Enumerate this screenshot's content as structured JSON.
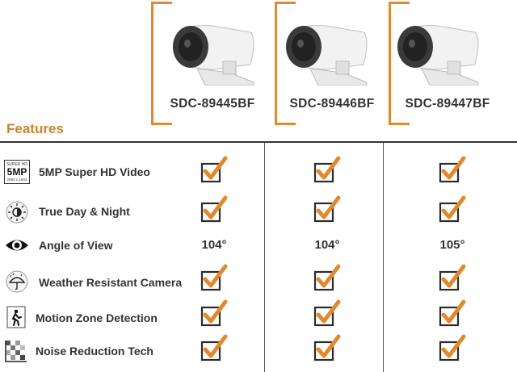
{
  "colors": {
    "accent": "#E0892D",
    "title": "#C8852B",
    "text": "#333333"
  },
  "products": [
    {
      "model": "SDC-89445BF"
    },
    {
      "model": "SDC-89446BF"
    },
    {
      "model": "SDC-89447BF"
    }
  ],
  "features_title": "Features",
  "features": [
    {
      "label": "5MP Super HD Video",
      "icon": "5mp-icon",
      "icon_text": [
        "SUPER HD",
        "5MP",
        "2592 x 1944"
      ],
      "values": [
        "check",
        "check",
        "check"
      ]
    },
    {
      "label": "True Day & Night",
      "icon": "sun-moon-icon",
      "values": [
        "check",
        "check",
        "check"
      ]
    },
    {
      "label": "Angle of View",
      "icon": "eye-icon",
      "values": [
        "104°",
        "104°",
        "105°"
      ]
    },
    {
      "label": "Weather Resistant Camera",
      "icon": "umbrella-icon",
      "values": [
        "check",
        "check",
        "check"
      ]
    },
    {
      "label": "Motion Zone Detection",
      "icon": "motion-icon",
      "values": [
        "check",
        "check",
        "check"
      ]
    },
    {
      "label": "Noise Reduction Tech",
      "icon": "noise-icon",
      "values": [
        "check",
        "check",
        "check"
      ]
    }
  ]
}
